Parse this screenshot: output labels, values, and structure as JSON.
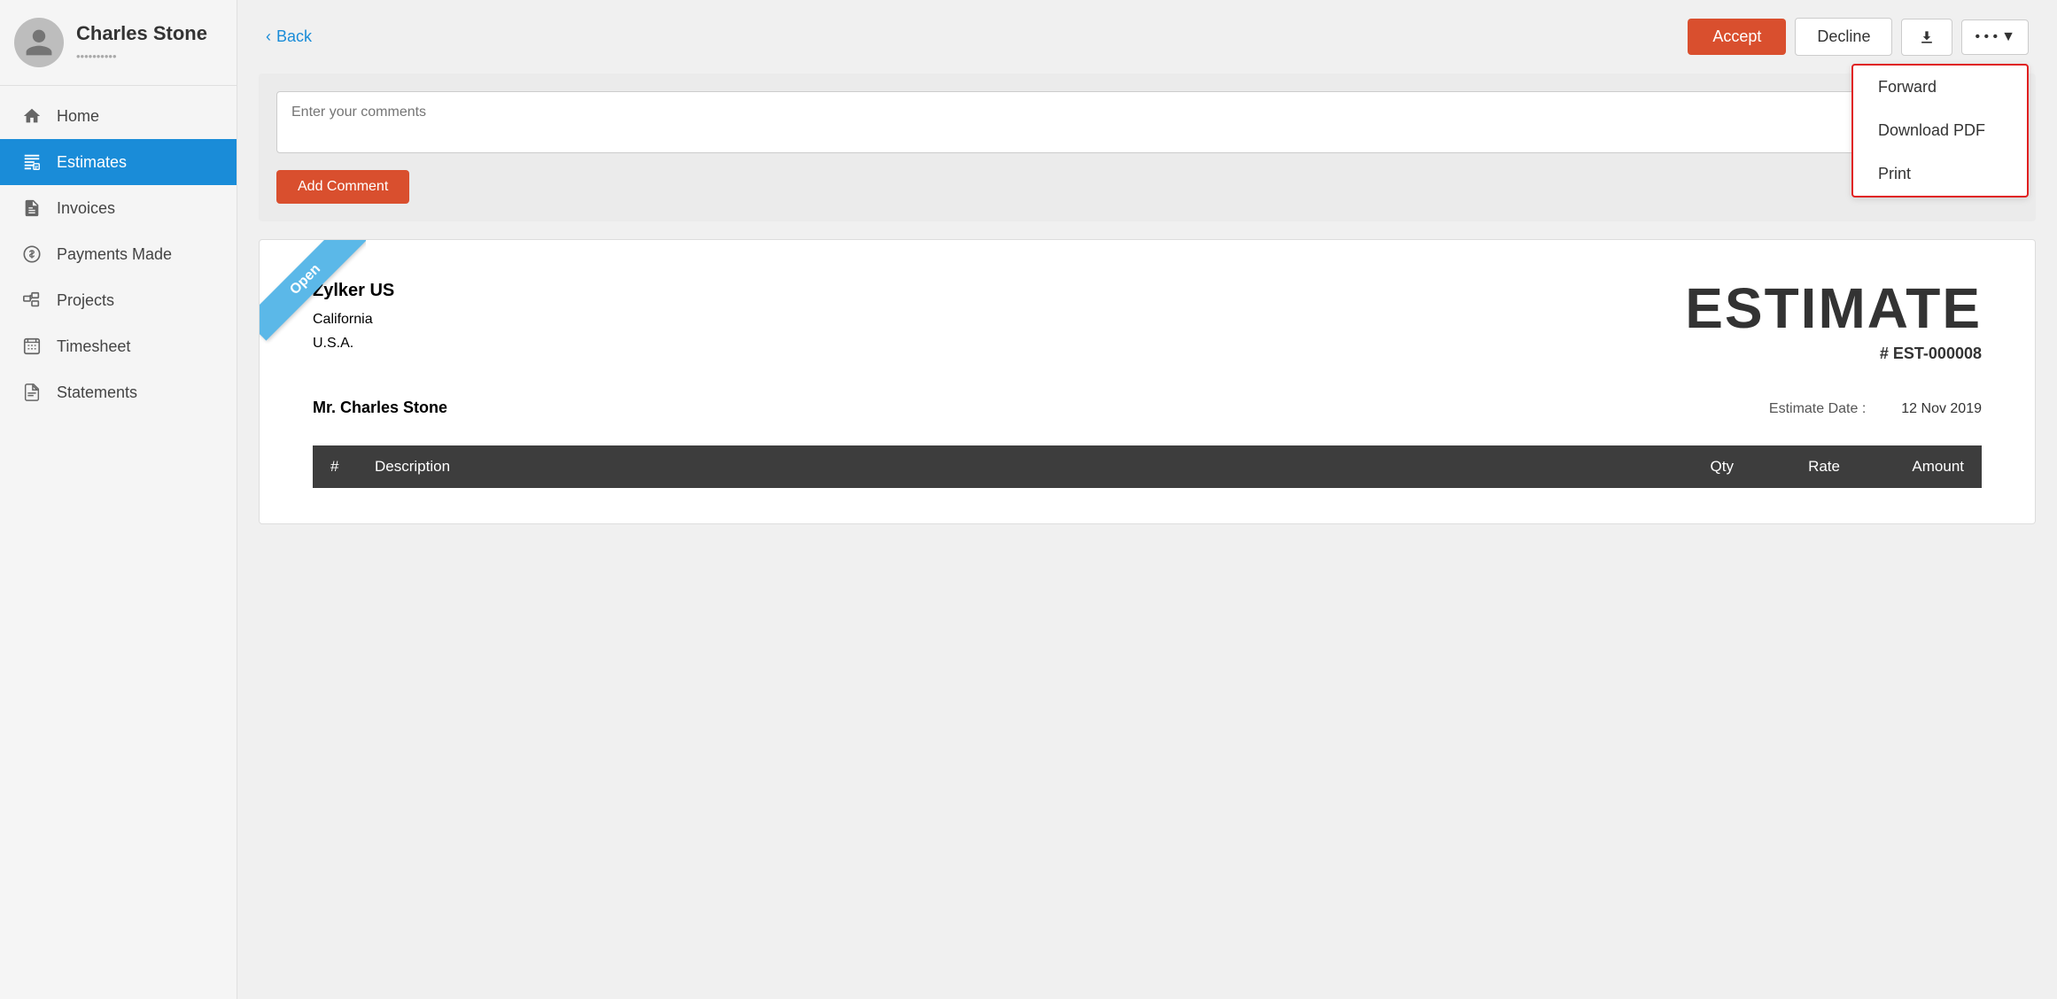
{
  "user": {
    "name": "Charles Stone",
    "subtitle": "••••••••••"
  },
  "sidebar": {
    "items": [
      {
        "id": "home",
        "label": "Home",
        "icon": "home-icon",
        "active": false
      },
      {
        "id": "estimates",
        "label": "Estimates",
        "icon": "estimates-icon",
        "active": true
      },
      {
        "id": "invoices",
        "label": "Invoices",
        "icon": "invoices-icon",
        "active": false
      },
      {
        "id": "payments",
        "label": "Payments Made",
        "icon": "payments-icon",
        "active": false
      },
      {
        "id": "projects",
        "label": "Projects",
        "icon": "projects-icon",
        "active": false
      },
      {
        "id": "timesheet",
        "label": "Timesheet",
        "icon": "timesheet-icon",
        "active": false
      },
      {
        "id": "statements",
        "label": "Statements",
        "icon": "statements-icon",
        "active": false
      }
    ]
  },
  "header": {
    "back_label": "Back",
    "accept_label": "Accept",
    "decline_label": "Decline"
  },
  "dropdown": {
    "items": [
      {
        "id": "forward",
        "label": "Forward"
      },
      {
        "id": "download-pdf",
        "label": "Download PDF"
      },
      {
        "id": "print",
        "label": "Print"
      }
    ]
  },
  "comments": {
    "placeholder": "Enter your comments",
    "add_button_label": "Add Comment"
  },
  "document": {
    "ribbon_label": "Open",
    "company_name": "Zylker US",
    "company_line1": "California",
    "company_line2": "U.S.A.",
    "title": "ESTIMATE",
    "number": "# EST-000008",
    "client_name": "Mr. Charles Stone",
    "estimate_date_label": "Estimate Date :",
    "estimate_date_value": "12 Nov 2019",
    "table_headers": [
      "#",
      "Description",
      "Qty",
      "Rate",
      "Amount"
    ]
  }
}
